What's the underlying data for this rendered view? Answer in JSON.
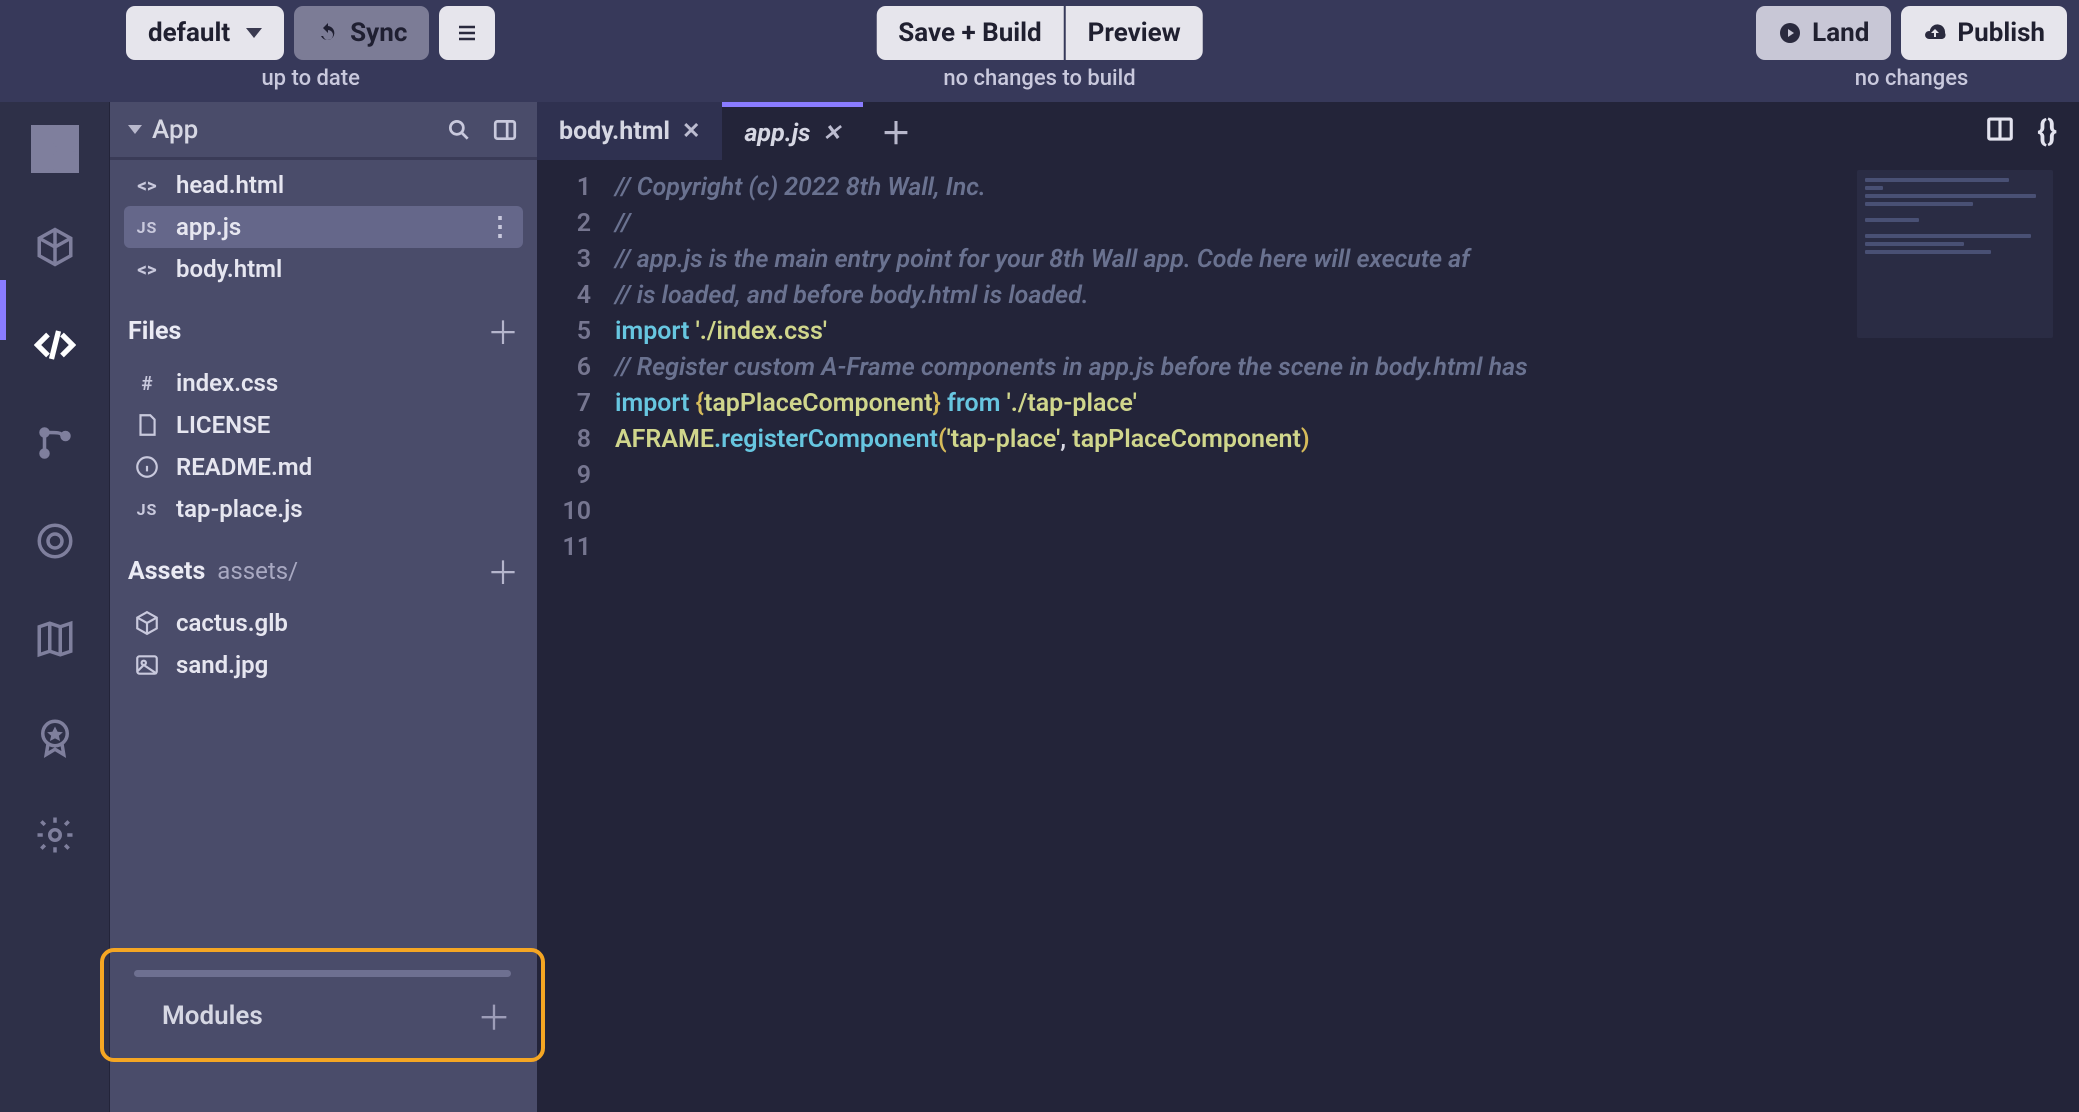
{
  "top": {
    "branch": "default",
    "sync": "Sync",
    "left_status": "up to date",
    "save": "Save + Build",
    "preview": "Preview",
    "center_status": "no changes to build",
    "land": "Land",
    "publish": "Publish",
    "right_status": "no changes"
  },
  "sidebar": {
    "app_label": "App",
    "entries": [
      {
        "icon": "<>",
        "name": "head.html"
      },
      {
        "icon": "JS",
        "name": "app.js",
        "active": true
      },
      {
        "icon": "<>",
        "name": "body.html"
      }
    ],
    "files_label": "Files",
    "files": [
      {
        "icon": "#",
        "name": "index.css"
      },
      {
        "icon": "doc",
        "name": "LICENSE"
      },
      {
        "icon": "info",
        "name": "README.md"
      },
      {
        "icon": "JS",
        "name": "tap-place.js"
      }
    ],
    "assets_label": "Assets",
    "assets_path": "assets/",
    "assets": [
      {
        "icon": "cube",
        "name": "cactus.glb"
      },
      {
        "icon": "img",
        "name": "sand.jpg"
      }
    ],
    "modules_label": "Modules"
  },
  "tabs": [
    {
      "name": "body.html",
      "active": false
    },
    {
      "name": "app.js",
      "active": true
    }
  ],
  "code": {
    "lines": [
      "// Copyright (c) 2022 8th Wall, Inc.",
      "//",
      "// app.js is the main entry point for your 8th Wall app. Code here will execute af",
      "// is loaded, and before body.html is loaded.",
      "",
      "import './index.css'",
      "",
      "// Register custom A-Frame components in app.js before the scene in body.html has",
      "import {tapPlaceComponent} from './tap-place'",
      "AFRAME.registerComponent('tap-place', tapPlaceComponent)",
      ""
    ]
  }
}
